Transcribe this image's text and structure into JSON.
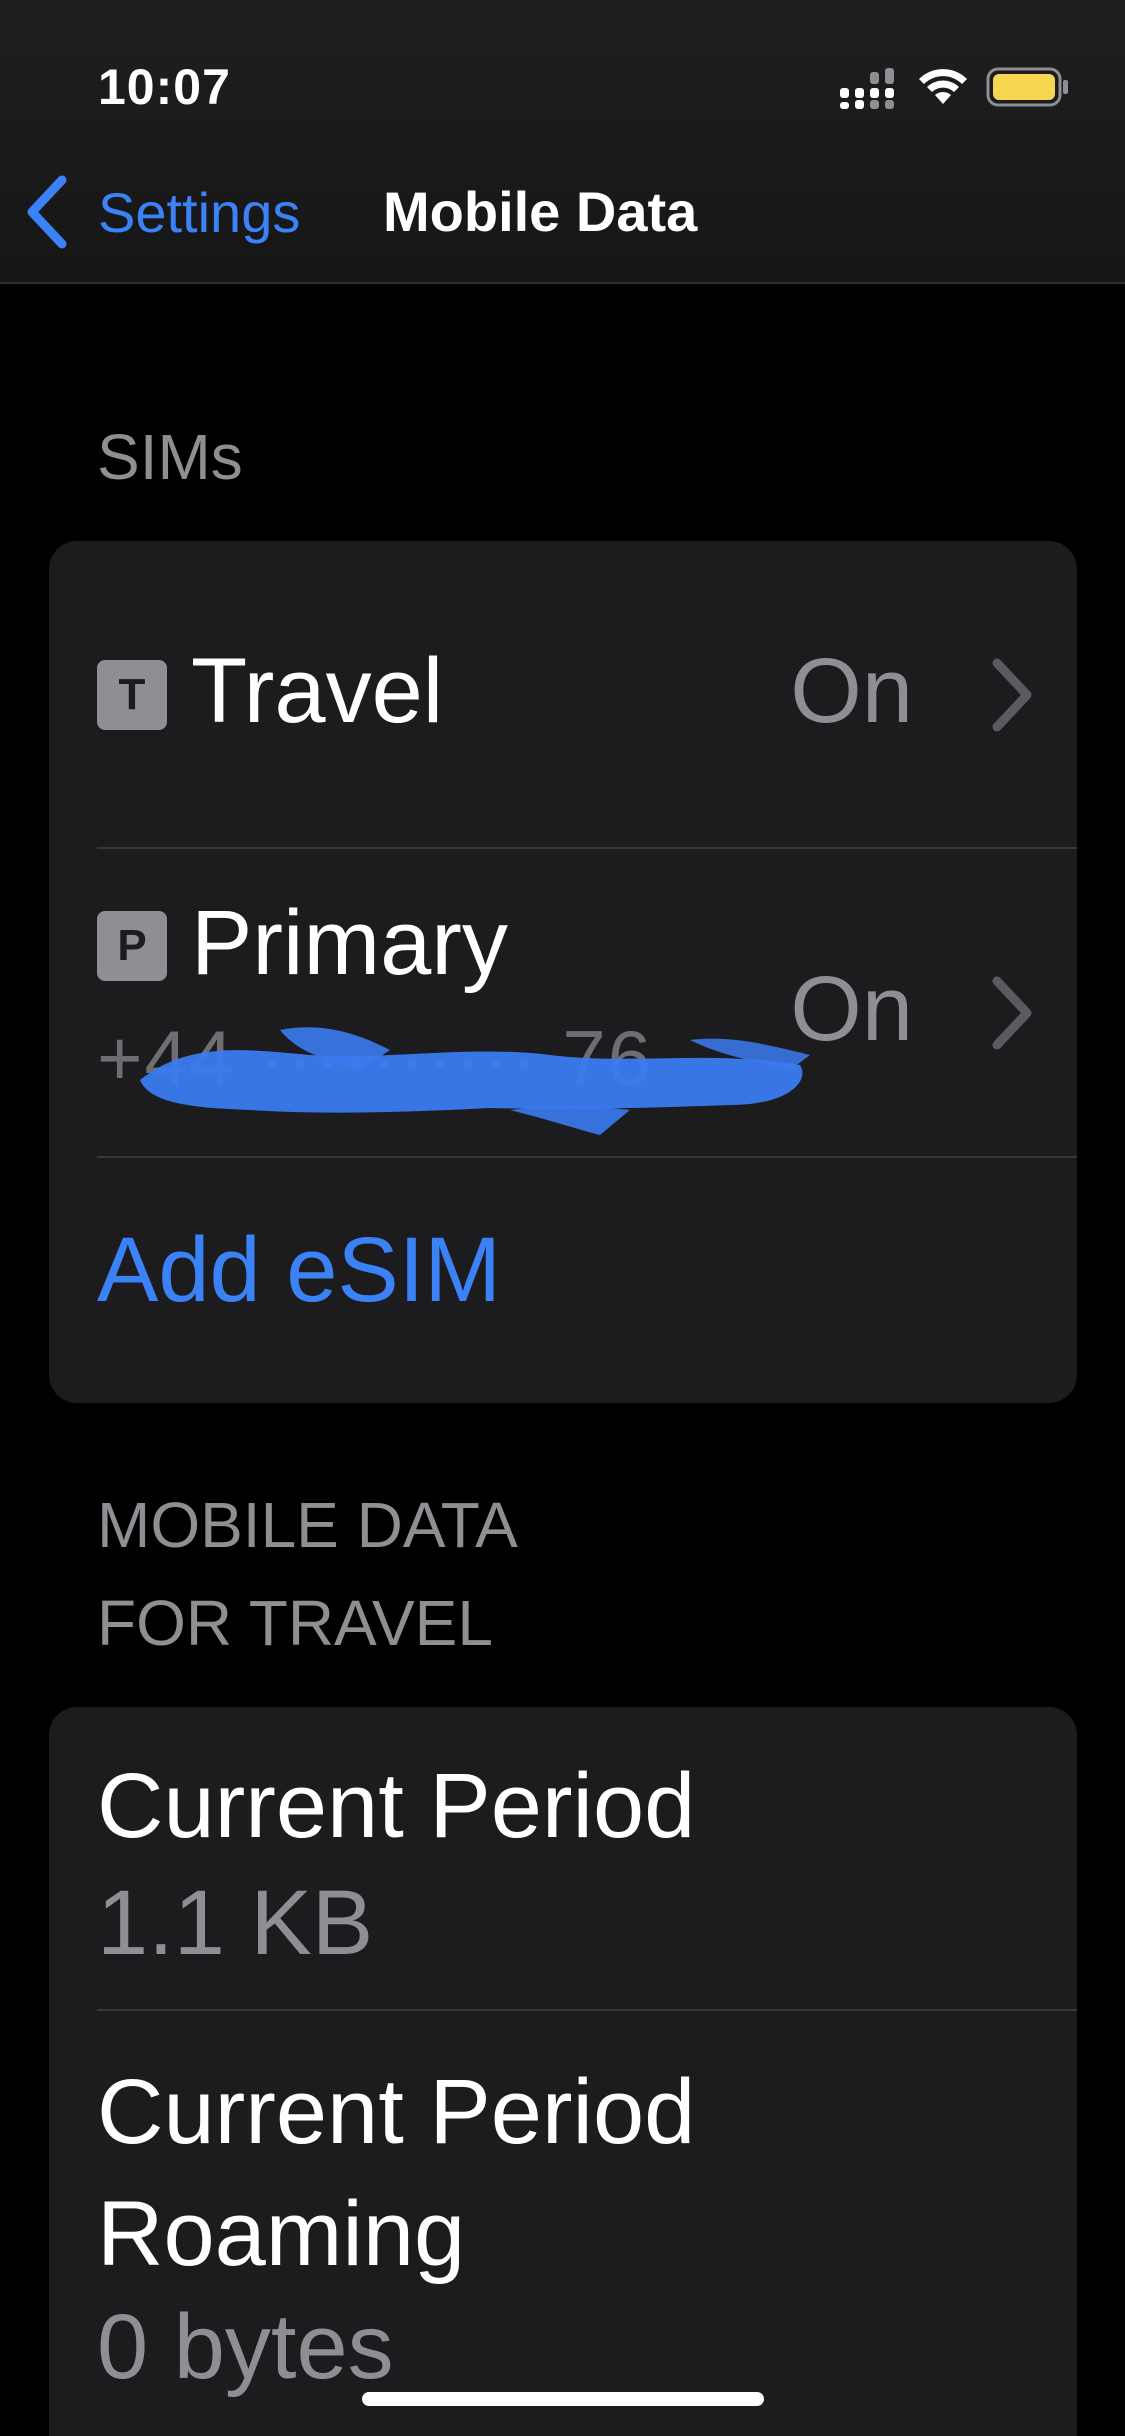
{
  "status_bar": {
    "time": "10:07",
    "battery_color": "#f5d552"
  },
  "nav": {
    "back_label": "Settings",
    "title": "Mobile Data"
  },
  "sims_section": {
    "header": "SIMs",
    "items": [
      {
        "badge": "T",
        "label": "Travel",
        "value": "On"
      },
      {
        "badge": "P",
        "label": "Primary",
        "value": "On",
        "number": "+44 ·········· 76",
        "number_redacted": true
      }
    ],
    "add_label": "Add eSIM"
  },
  "usage_section": {
    "header_line1": "MOBILE DATA",
    "header_line2": "FOR TRAVEL",
    "items": [
      {
        "title": "Current Period",
        "value": "1.1 KB"
      },
      {
        "title_line1": "Current Period",
        "title_line2": "Roaming",
        "value": "0 bytes"
      }
    ]
  },
  "colors": {
    "accent": "#3b82f6",
    "background": "#000000",
    "card": "#1c1c1e",
    "secondary_text": "#8e8e93"
  }
}
